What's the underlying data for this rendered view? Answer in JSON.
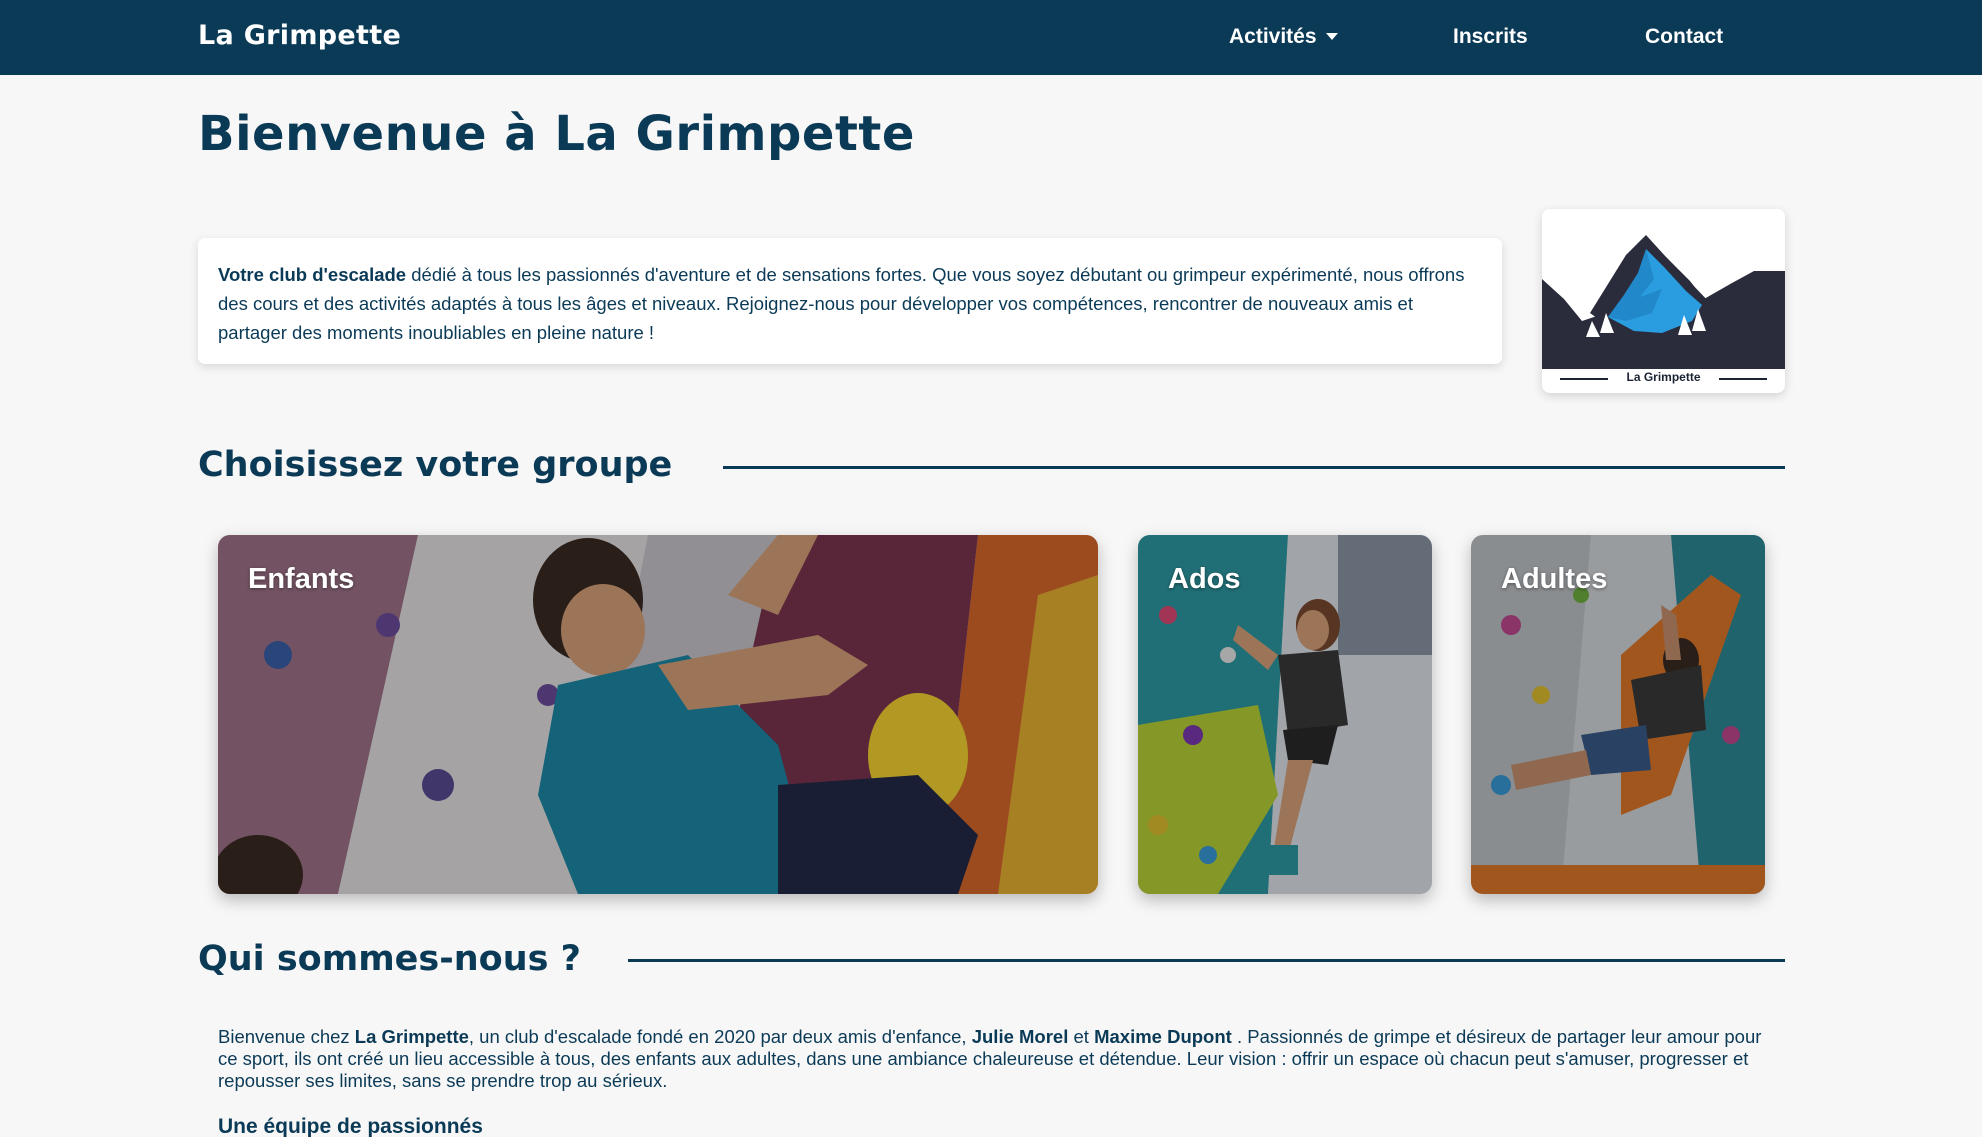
{
  "nav": {
    "brand": "La Grimpette",
    "items": [
      {
        "label": "Activités",
        "dropdown": true
      },
      {
        "label": "Inscrits"
      },
      {
        "label": "Contact"
      }
    ]
  },
  "page_title": "Bienvenue à La Grimpette",
  "intro": {
    "strong": "Votre club d'escalade",
    "text": " dédié à tous les passionnés d'aventure et de sensations fortes. Que vous soyez débutant ou grimpeur expérimenté, nous offrons des cours et des activités adaptés à tous les âges et niveaux. Rejoignez-nous pour développer vos compétences, rencontrer de nouveaux amis et partager des moments inoubliables en pleine nature !"
  },
  "logo": {
    "caption": "La Grimpette"
  },
  "groups_section": {
    "title": "Choisissez votre groupe",
    "groups": [
      {
        "label": "Enfants"
      },
      {
        "label": "Ados"
      },
      {
        "label": "Adultes"
      }
    ]
  },
  "about_section": {
    "title": "Qui sommes-nous ?",
    "p_1": "Bienvenue chez ",
    "club": "La Grimpette",
    "p_2": ", un club d'escalade fondé en 2020 par deux amis d'enfance, ",
    "founder_1": "Julie Morel",
    "p_3": " et ",
    "founder_2": "Maxime Dupont",
    "p_4": " . Passionnés de grimpe et désireux de partager leur amour pour ce sport, ils ont créé un lieu accessible à tous, des enfants aux adultes, dans une ambiance chaleureuse et détendue. Leur vision : offrir un espace où chacun peut s'amuser, progresser et repousser ses limites, sans se prendre trop au sérieux.",
    "subheading": "Une équipe de passionnés"
  },
  "colors": {
    "primary": "#0b3a57",
    "background": "#f7f7f7",
    "card": "#ffffff",
    "logo_blue": "#2a9de0",
    "logo_dark": "#2a2c3c"
  },
  "icons": {
    "dropdown": "caret-down-icon",
    "logo": "mountain-logo"
  }
}
